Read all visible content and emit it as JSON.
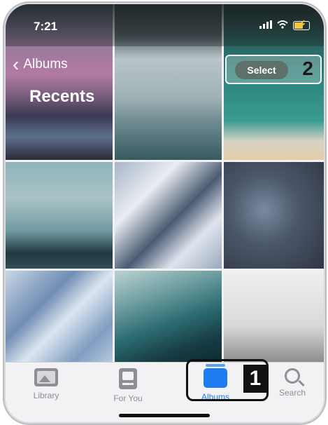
{
  "status_bar": {
    "time": "7:21",
    "signal_icon": "signal-bars-icon",
    "wifi_icon": "wifi-icon",
    "battery_icon": "battery-charging-icon"
  },
  "nav": {
    "back_label": "Albums",
    "title": "Recents",
    "select_label": "Select"
  },
  "callouts": {
    "select": "2",
    "albums": "1"
  },
  "photos": [
    {
      "name": "sunset-sea"
    },
    {
      "name": "misty-mountains"
    },
    {
      "name": "aerial-beach"
    },
    {
      "name": "foggy-forest"
    },
    {
      "name": "ice-shelf"
    },
    {
      "name": "cracked-ground"
    },
    {
      "name": "ice-texture"
    },
    {
      "name": "ocean-wave"
    },
    {
      "name": "building-corner"
    }
  ],
  "tabbar": {
    "tabs": [
      {
        "label": "Library",
        "icon": "photo-library-icon"
      },
      {
        "label": "For You",
        "icon": "for-you-icon"
      },
      {
        "label": "Albums",
        "icon": "albums-stack-icon",
        "selected": true
      },
      {
        "label": "Search",
        "icon": "magnifier-icon"
      }
    ]
  },
  "colors": {
    "accent": "#1e7cf2",
    "inactive": "#8e8e93"
  }
}
